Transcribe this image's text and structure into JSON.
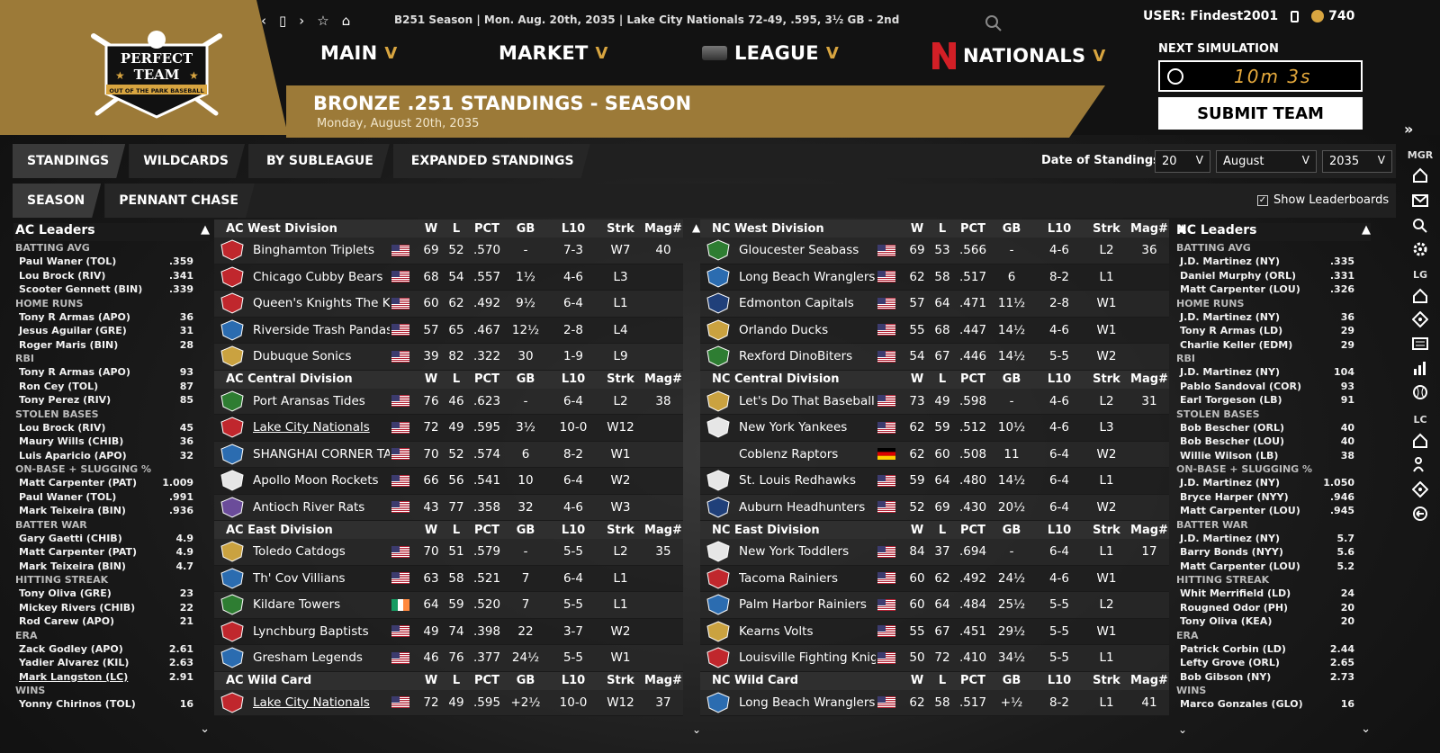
{
  "brand": {
    "logo_line1": "PERFECT",
    "logo_line2": "TEAM",
    "logo_ribbon": "OUT OF THE PARK BASEBALL"
  },
  "ticker": "B251 Season  |  Mon. Aug. 20th, 2035  |  Lake City Nationals   72-49, .595, 3½ GB - 2nd",
  "menus": {
    "main": "MAIN",
    "market": "MARKET",
    "league": "LEAGUE",
    "team": "NATIONALS",
    "chev": "V"
  },
  "page": {
    "title": "BRONZE .251 STANDINGS - SEASON",
    "date": "Monday, August 20th, 2035"
  },
  "user": {
    "label": "USER: Findest2001",
    "coins": "740",
    "next_sim": "NEXT SIMULATION",
    "timer": "10m 3s",
    "submit": "SUBMIT TEAM"
  },
  "tabs": {
    "primary": [
      "STANDINGS",
      "WILDCARDS",
      "BY SUBLEAGUE",
      "EXPANDED STANDINGS"
    ],
    "secondary": [
      "SEASON",
      "PENNANT CHASE"
    ]
  },
  "date_filter": {
    "label": "Date of Standings:",
    "day": "20",
    "month": "August",
    "year": "2035"
  },
  "show_leaderboards": "Show Leaderboards",
  "side_labels": {
    "mgr": "MGR",
    "lg": "LG",
    "lc": "LC"
  },
  "ac_leaders": {
    "title": "AC Leaders",
    "cats": [
      {
        "name": "BATTING AVG",
        "rows": [
          [
            "Paul Waner (TOL)",
            ".359"
          ],
          [
            "Lou Brock (RIV)",
            ".341"
          ],
          [
            "Scooter Gennett (BIN)",
            ".339"
          ]
        ]
      },
      {
        "name": "HOME RUNS",
        "rows": [
          [
            "Tony R Armas (APO)",
            "36"
          ],
          [
            "Jesus Aguilar (GRE)",
            "31"
          ],
          [
            "Roger Maris (BIN)",
            "28"
          ]
        ]
      },
      {
        "name": "RBI",
        "rows": [
          [
            "Tony R Armas (APO)",
            "93"
          ],
          [
            "Ron Cey (TOL)",
            "87"
          ],
          [
            "Tony Perez (RIV)",
            "85"
          ]
        ]
      },
      {
        "name": "STOLEN BASES",
        "rows": [
          [
            "Lou Brock (RIV)",
            "45"
          ],
          [
            "Maury Wills (CHIB)",
            "36"
          ],
          [
            "Luis Aparicio (APO)",
            "32"
          ]
        ]
      },
      {
        "name": "ON-BASE + SLUGGING %",
        "rows": [
          [
            "Matt Carpenter (PAT)",
            "1.009"
          ],
          [
            "Paul Waner (TOL)",
            ".991"
          ],
          [
            "Mark Teixeira (BIN)",
            ".936"
          ]
        ]
      },
      {
        "name": "BATTER WAR",
        "rows": [
          [
            "Gary Gaetti (CHIB)",
            "4.9"
          ],
          [
            "Matt Carpenter (PAT)",
            "4.9"
          ],
          [
            "Mark Teixeira (BIN)",
            "4.7"
          ]
        ]
      },
      {
        "name": "HITTING STREAK",
        "rows": [
          [
            "Tony Oliva (GRE)",
            "23"
          ],
          [
            "Mickey Rivers (CHIB)",
            "22"
          ],
          [
            "Rod Carew (APO)",
            "21"
          ]
        ]
      },
      {
        "name": "ERA",
        "rows": [
          [
            "Zack Godley (APO)",
            "2.61"
          ],
          [
            "Yadier Alvarez (KIL)",
            "2.63"
          ],
          [
            "Mark Langston (LC)",
            "2.91"
          ]
        ]
      },
      {
        "name": "WINS",
        "rows": [
          [
            "Yonny Chirinos (TOL)",
            "16"
          ]
        ]
      }
    ]
  },
  "nc_leaders": {
    "title": "NC Leaders",
    "cats": [
      {
        "name": "BATTING AVG",
        "rows": [
          [
            "J.D. Martinez (NY)",
            ".335"
          ],
          [
            "Daniel Murphy (ORL)",
            ".331"
          ],
          [
            "Matt Carpenter (LOU)",
            ".326"
          ]
        ]
      },
      {
        "name": "HOME RUNS",
        "rows": [
          [
            "J.D. Martinez (NY)",
            "36"
          ],
          [
            "Tony R Armas (LD)",
            "29"
          ],
          [
            "Charlie Keller (EDM)",
            "29"
          ]
        ]
      },
      {
        "name": "RBI",
        "rows": [
          [
            "J.D. Martinez (NY)",
            "104"
          ],
          [
            "Pablo Sandoval (COR)",
            "93"
          ],
          [
            "Earl Torgeson (LB)",
            "91"
          ]
        ]
      },
      {
        "name": "STOLEN BASES",
        "rows": [
          [
            "Bob Bescher (ORL)",
            "40"
          ],
          [
            "Bob Bescher (LOU)",
            "40"
          ],
          [
            "Willie Wilson (LB)",
            "38"
          ]
        ]
      },
      {
        "name": "ON-BASE + SLUGGING %",
        "rows": [
          [
            "J.D. Martinez (NY)",
            "1.050"
          ],
          [
            "Bryce Harper (NYY)",
            ".946"
          ],
          [
            "Matt Carpenter (LOU)",
            ".945"
          ]
        ]
      },
      {
        "name": "BATTER WAR",
        "rows": [
          [
            "J.D. Martinez (NY)",
            "5.7"
          ],
          [
            "Barry Bonds (NYY)",
            "5.6"
          ],
          [
            "Matt Carpenter (LOU)",
            "5.2"
          ]
        ]
      },
      {
        "name": "HITTING STREAK",
        "rows": [
          [
            "Whit Merrifield (LD)",
            "24"
          ],
          [
            "Rougned Odor (PH)",
            "20"
          ],
          [
            "Tony Oliva (KEA)",
            "20"
          ]
        ]
      },
      {
        "name": "ERA",
        "rows": [
          [
            "Patrick Corbin (LD)",
            "2.44"
          ],
          [
            "Lefty Grove (ORL)",
            "2.65"
          ],
          [
            "Bob Gibson (NY)",
            "2.73"
          ]
        ]
      },
      {
        "name": "WINS",
        "rows": [
          [
            "Marco Gonzales (GLO)",
            "16"
          ]
        ]
      }
    ]
  },
  "columns": [
    "W",
    "L",
    "PCT",
    "GB",
    "L10",
    "Strk",
    "Mag#"
  ],
  "ac_standings": [
    {
      "division": "AC West Division",
      "teams": [
        {
          "name": "Binghamton Triplets",
          "flag": "us",
          "w": "69",
          "l": "52",
          "pct": ".570",
          "gb": "-",
          "l10": "7-3",
          "strk": "W7",
          "mag": "40",
          "logo": "red"
        },
        {
          "name": "Chicago Cubby Bears",
          "flag": "us",
          "w": "68",
          "l": "54",
          "pct": ".557",
          "gb": "1½",
          "l10": "4-6",
          "strk": "L3",
          "mag": "",
          "logo": "red"
        },
        {
          "name": "Queen's Knights The Knights",
          "flag": "us",
          "w": "60",
          "l": "62",
          "pct": ".492",
          "gb": "9½",
          "l10": "6-4",
          "strk": "L1",
          "mag": "",
          "logo": "red"
        },
        {
          "name": "Riverside Trash Pandas",
          "flag": "us",
          "w": "57",
          "l": "65",
          "pct": ".467",
          "gb": "12½",
          "l10": "2-8",
          "strk": "L4",
          "mag": "",
          "logo": "blue"
        },
        {
          "name": "Dubuque Sonics",
          "flag": "us",
          "w": "39",
          "l": "82",
          "pct": ".322",
          "gb": "30",
          "l10": "1-9",
          "strk": "L9",
          "mag": "",
          "logo": "gold"
        }
      ]
    },
    {
      "division": "AC Central Division",
      "teams": [
        {
          "name": "Port Aransas Tides",
          "flag": "us",
          "w": "76",
          "l": "46",
          "pct": ".623",
          "gb": "-",
          "l10": "6-4",
          "strk": "L2",
          "mag": "38",
          "logo": "green"
        },
        {
          "name": "Lake City Nationals",
          "flag": "us",
          "w": "72",
          "l": "49",
          "pct": ".595",
          "gb": "3½",
          "l10": "10-0",
          "strk": "W12",
          "mag": "",
          "logo": "red",
          "own": true
        },
        {
          "name": "SHANGHAI CORNER TACOS",
          "flag": "us",
          "w": "70",
          "l": "52",
          "pct": ".574",
          "gb": "6",
          "l10": "8-2",
          "strk": "W1",
          "mag": "",
          "logo": "blue"
        },
        {
          "name": "Apollo Moon Rockets",
          "flag": "us",
          "w": "66",
          "l": "56",
          "pct": ".541",
          "gb": "10",
          "l10": "6-4",
          "strk": "W2",
          "mag": "",
          "logo": "white"
        },
        {
          "name": "Antioch River Rats",
          "flag": "us",
          "w": "43",
          "l": "77",
          "pct": ".358",
          "gb": "32",
          "l10": "4-6",
          "strk": "W3",
          "mag": "",
          "logo": "purple"
        }
      ]
    },
    {
      "division": "AC East Division",
      "teams": [
        {
          "name": "Toledo Catdogs",
          "flag": "us",
          "w": "70",
          "l": "51",
          "pct": ".579",
          "gb": "-",
          "l10": "5-5",
          "strk": "L2",
          "mag": "35",
          "logo": "gold"
        },
        {
          "name": "Th' Cov Villians",
          "flag": "us",
          "w": "63",
          "l": "58",
          "pct": ".521",
          "gb": "7",
          "l10": "6-4",
          "strk": "L1",
          "mag": "",
          "logo": "blue"
        },
        {
          "name": "Kildare Towers",
          "flag": "ie",
          "w": "64",
          "l": "59",
          "pct": ".520",
          "gb": "7",
          "l10": "5-5",
          "strk": "L1",
          "mag": "",
          "logo": "green"
        },
        {
          "name": "Lynchburg Baptists",
          "flag": "us",
          "w": "49",
          "l": "74",
          "pct": ".398",
          "gb": "22",
          "l10": "3-7",
          "strk": "W2",
          "mag": "",
          "logo": "red"
        },
        {
          "name": "Gresham Legends",
          "flag": "us",
          "w": "46",
          "l": "76",
          "pct": ".377",
          "gb": "24½",
          "l10": "5-5",
          "strk": "W1",
          "mag": "",
          "logo": "blue"
        }
      ]
    },
    {
      "division": "AC  Wild Card",
      "teams": [
        {
          "name": "Lake City Nationals",
          "flag": "us",
          "w": "72",
          "l": "49",
          "pct": ".595",
          "gb": "+2½",
          "l10": "10-0",
          "strk": "W12",
          "mag": "37",
          "logo": "red",
          "own": true
        }
      ]
    }
  ],
  "nc_standings": [
    {
      "division": "NC West Division",
      "teams": [
        {
          "name": "Gloucester Seabass",
          "flag": "us",
          "w": "69",
          "l": "53",
          "pct": ".566",
          "gb": "-",
          "l10": "4-6",
          "strk": "L2",
          "mag": "36",
          "logo": "green"
        },
        {
          "name": "Long Beach Wranglers",
          "flag": "us",
          "w": "62",
          "l": "58",
          "pct": ".517",
          "gb": "6",
          "l10": "8-2",
          "strk": "L1",
          "mag": "",
          "logo": "blue"
        },
        {
          "name": "Edmonton Capitals",
          "flag": "us",
          "w": "57",
          "l": "64",
          "pct": ".471",
          "gb": "11½",
          "l10": "2-8",
          "strk": "W1",
          "mag": "",
          "logo": "navy"
        },
        {
          "name": "Orlando Ducks",
          "flag": "us",
          "w": "55",
          "l": "68",
          "pct": ".447",
          "gb": "14½",
          "l10": "4-6",
          "strk": "W1",
          "mag": "",
          "logo": "gold"
        },
        {
          "name": "Rexford DinoBiters",
          "flag": "us",
          "w": "54",
          "l": "67",
          "pct": ".446",
          "gb": "14½",
          "l10": "5-5",
          "strk": "W2",
          "mag": "",
          "logo": "green"
        }
      ]
    },
    {
      "division": "NC Central Division",
      "teams": [
        {
          "name": "Let's Do That Baseball",
          "flag": "us",
          "w": "73",
          "l": "49",
          "pct": ".598",
          "gb": "-",
          "l10": "4-6",
          "strk": "L2",
          "mag": "31",
          "logo": "gold"
        },
        {
          "name": "New York Yankees",
          "flag": "us",
          "w": "62",
          "l": "59",
          "pct": ".512",
          "gb": "10½",
          "l10": "4-6",
          "strk": "L3",
          "mag": "",
          "logo": "white"
        },
        {
          "name": "Coblenz Raptors",
          "flag": "de",
          "w": "62",
          "l": "60",
          "pct": ".508",
          "gb": "11",
          "l10": "6-4",
          "strk": "W2",
          "mag": "",
          "logo": "none"
        },
        {
          "name": "St. Louis Redhawks",
          "flag": "us",
          "w": "59",
          "l": "64",
          "pct": ".480",
          "gb": "14½",
          "l10": "6-4",
          "strk": "L1",
          "mag": "",
          "logo": "white"
        },
        {
          "name": "Auburn Headhunters",
          "flag": "us",
          "w": "52",
          "l": "69",
          "pct": ".430",
          "gb": "20½",
          "l10": "6-4",
          "strk": "W2",
          "mag": "",
          "logo": "navy"
        }
      ]
    },
    {
      "division": "NC East Division",
      "teams": [
        {
          "name": "New York Toddlers",
          "flag": "us",
          "w": "84",
          "l": "37",
          "pct": ".694",
          "gb": "-",
          "l10": "6-4",
          "strk": "L1",
          "mag": "17",
          "logo": "white"
        },
        {
          "name": "Tacoma Rainiers",
          "flag": "us",
          "w": "60",
          "l": "62",
          "pct": ".492",
          "gb": "24½",
          "l10": "4-6",
          "strk": "W1",
          "mag": "",
          "logo": "red"
        },
        {
          "name": "Palm Harbor Rainiers",
          "flag": "us",
          "w": "60",
          "l": "64",
          "pct": ".484",
          "gb": "25½",
          "l10": "5-5",
          "strk": "L2",
          "mag": "",
          "logo": "blue"
        },
        {
          "name": "Kearns Volts",
          "flag": "us",
          "w": "55",
          "l": "67",
          "pct": ".451",
          "gb": "29½",
          "l10": "5-5",
          "strk": "W1",
          "mag": "",
          "logo": "gold"
        },
        {
          "name": "Louisville Fighting Knights",
          "flag": "us",
          "w": "50",
          "l": "72",
          "pct": ".410",
          "gb": "34½",
          "l10": "5-5",
          "strk": "L1",
          "mag": "",
          "logo": "red"
        }
      ]
    },
    {
      "division": "NC  Wild Card",
      "teams": [
        {
          "name": "Long Beach Wranglers",
          "flag": "us",
          "w": "62",
          "l": "58",
          "pct": ".517",
          "gb": "+½",
          "l10": "8-2",
          "strk": "L1",
          "mag": "41",
          "logo": "blue"
        }
      ]
    }
  ],
  "colors": {
    "gold": "#9c7a38",
    "accent": "#e5a93c",
    "panel": "#262626"
  }
}
